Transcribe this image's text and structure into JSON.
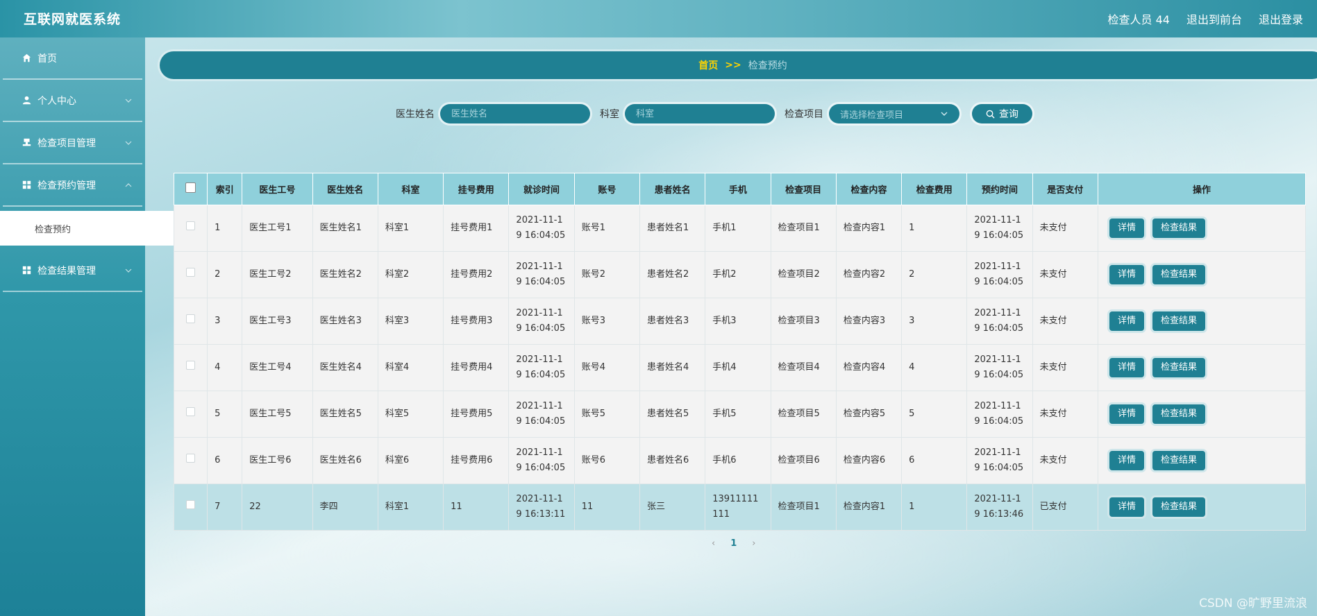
{
  "app": {
    "title": "互联网就医系统"
  },
  "topnav": {
    "user": "检查人员 44",
    "front": "退出到前台",
    "logout": "退出登录"
  },
  "sidebar": {
    "items": [
      {
        "label": "首页",
        "icon": "home-icon"
      },
      {
        "label": "个人中心",
        "icon": "user-icon"
      },
      {
        "label": "检查项目管理",
        "icon": "stamp-icon"
      },
      {
        "label": "检查预约管理",
        "icon": "grid-icon"
      },
      {
        "label": "检查结果管理",
        "icon": "grid-icon"
      }
    ],
    "subitem": "检查预约"
  },
  "breadcrumb": {
    "home": "首页",
    "sep": ">>",
    "current": "检查预约"
  },
  "search": {
    "doctor_label": "医生姓名",
    "doctor_placeholder": "医生姓名",
    "dept_label": "科室",
    "dept_placeholder": "科室",
    "item_label": "检查项目",
    "item_placeholder": "请选择检查项目",
    "button": "查询"
  },
  "table": {
    "headers": [
      "索引",
      "医生工号",
      "医生姓名",
      "科室",
      "挂号费用",
      "就诊时间",
      "账号",
      "患者姓名",
      "手机",
      "检查项目",
      "检查内容",
      "检查费用",
      "预约时间",
      "是否支付",
      "操作"
    ],
    "rows": [
      [
        "1",
        "医生工号1",
        "医生姓名1",
        "科室1",
        "挂号费用1",
        "2021-11-19 16:04:05",
        "账号1",
        "患者姓名1",
        "手机1",
        "检查项目1",
        "检查内容1",
        "1",
        "2021-11-19 16:04:05",
        "未支付"
      ],
      [
        "2",
        "医生工号2",
        "医生姓名2",
        "科室2",
        "挂号费用2",
        "2021-11-19 16:04:05",
        "账号2",
        "患者姓名2",
        "手机2",
        "检查项目2",
        "检查内容2",
        "2",
        "2021-11-19 16:04:05",
        "未支付"
      ],
      [
        "3",
        "医生工号3",
        "医生姓名3",
        "科室3",
        "挂号费用3",
        "2021-11-19 16:04:05",
        "账号3",
        "患者姓名3",
        "手机3",
        "检查项目3",
        "检查内容3",
        "3",
        "2021-11-19 16:04:05",
        "未支付"
      ],
      [
        "4",
        "医生工号4",
        "医生姓名4",
        "科室4",
        "挂号费用4",
        "2021-11-19 16:04:05",
        "账号4",
        "患者姓名4",
        "手机4",
        "检查项目4",
        "检查内容4",
        "4",
        "2021-11-19 16:04:05",
        "未支付"
      ],
      [
        "5",
        "医生工号5",
        "医生姓名5",
        "科室5",
        "挂号费用5",
        "2021-11-19 16:04:05",
        "账号5",
        "患者姓名5",
        "手机5",
        "检查项目5",
        "检查内容5",
        "5",
        "2021-11-19 16:04:05",
        "未支付"
      ],
      [
        "6",
        "医生工号6",
        "医生姓名6",
        "科室6",
        "挂号费用6",
        "2021-11-19 16:04:05",
        "账号6",
        "患者姓名6",
        "手机6",
        "检查项目6",
        "检查内容6",
        "6",
        "2021-11-19 16:04:05",
        "未支付"
      ],
      [
        "7",
        "22",
        "李四",
        "科室1",
        "11",
        "2021-11-19 16:13:11",
        "11",
        "张三",
        "13911111111",
        "检查项目1",
        "检查内容1",
        "1",
        "2021-11-19 16:13:46",
        "已支付"
      ]
    ],
    "actions": {
      "detail": "详情",
      "result": "检查结果"
    }
  },
  "pager": {
    "prev": "‹",
    "page": "1",
    "next": "›"
  },
  "watermark": "CSDN @旷野里流浪",
  "colors": {
    "primary": "#1f8093",
    "header": "#8fd0db",
    "accent": "#ffd400"
  }
}
